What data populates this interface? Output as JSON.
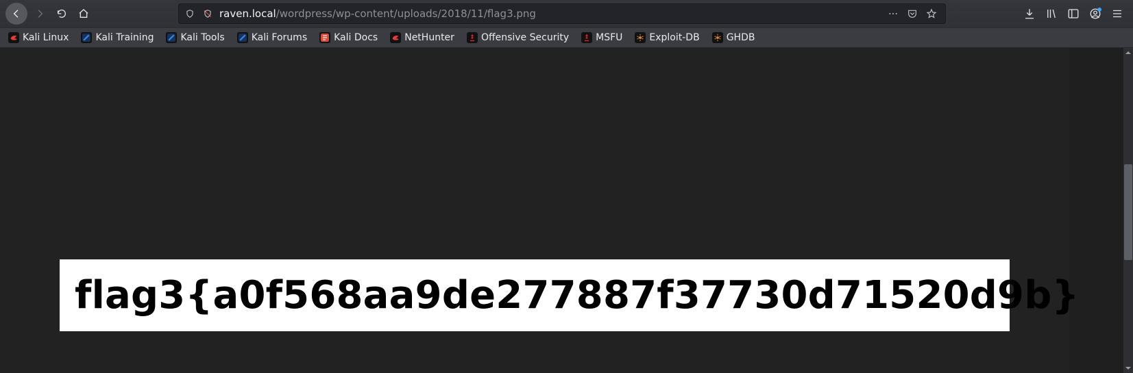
{
  "url": {
    "scheme": "",
    "host": "raven.local",
    "path": "/wordpress/wp-content/uploads/2018/11/flag3.png"
  },
  "bookmarks": [
    {
      "label": "Kali Linux",
      "icon": "kali-dragon",
      "color": "#e33b3b"
    },
    {
      "label": "Kali Training",
      "icon": "kali-slash",
      "color": "#3b84e3"
    },
    {
      "label": "Kali Tools",
      "icon": "kali-slash",
      "color": "#3b84e3"
    },
    {
      "label": "Kali Forums",
      "icon": "kali-slash",
      "color": "#3b84e3"
    },
    {
      "label": "Kali Docs",
      "icon": "kali-docs",
      "color": "#d94b3b"
    },
    {
      "label": "NetHunter",
      "icon": "kali-dragon",
      "color": "#e33b3b"
    },
    {
      "label": "Offensive Security",
      "icon": "pawn",
      "color": "#cc2b2b"
    },
    {
      "label": "MSFU",
      "icon": "pawn",
      "color": "#cc2b2b"
    },
    {
      "label": "Exploit-DB",
      "icon": "spider",
      "color": "#e08b2f"
    },
    {
      "label": "GHDB",
      "icon": "spider",
      "color": "#e08b2f"
    }
  ],
  "content": {
    "flag_text": "flag3{a0f568aa9de277887f37730d71520d9b}"
  }
}
